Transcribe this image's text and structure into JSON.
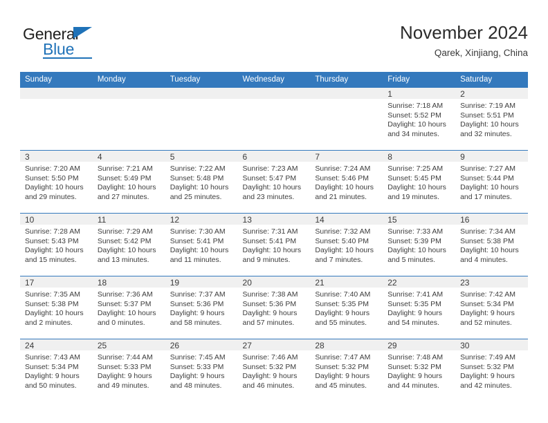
{
  "brand": {
    "name_top": "General",
    "name_bottom": "Blue",
    "accent_color": "#1f72b8"
  },
  "header": {
    "title": "November 2024",
    "subtitle": "Qarek, Xinjiang, China"
  },
  "calendar": {
    "header_background": "#3479bd",
    "weekday_headers": [
      "Sunday",
      "Monday",
      "Tuesday",
      "Wednesday",
      "Thursday",
      "Friday",
      "Saturday"
    ],
    "weeks": [
      [
        {
          "day": "",
          "empty": true
        },
        {
          "day": "",
          "empty": true
        },
        {
          "day": "",
          "empty": true
        },
        {
          "day": "",
          "empty": true
        },
        {
          "day": "",
          "empty": true
        },
        {
          "day": "1",
          "sunrise": "Sunrise: 7:18 AM",
          "sunset": "Sunset: 5:52 PM",
          "daylight_line1": "Daylight: 10 hours",
          "daylight_line2": "and 34 minutes."
        },
        {
          "day": "2",
          "sunrise": "Sunrise: 7:19 AM",
          "sunset": "Sunset: 5:51 PM",
          "daylight_line1": "Daylight: 10 hours",
          "daylight_line2": "and 32 minutes."
        }
      ],
      [
        {
          "day": "3",
          "sunrise": "Sunrise: 7:20 AM",
          "sunset": "Sunset: 5:50 PM",
          "daylight_line1": "Daylight: 10 hours",
          "daylight_line2": "and 29 minutes."
        },
        {
          "day": "4",
          "sunrise": "Sunrise: 7:21 AM",
          "sunset": "Sunset: 5:49 PM",
          "daylight_line1": "Daylight: 10 hours",
          "daylight_line2": "and 27 minutes."
        },
        {
          "day": "5",
          "sunrise": "Sunrise: 7:22 AM",
          "sunset": "Sunset: 5:48 PM",
          "daylight_line1": "Daylight: 10 hours",
          "daylight_line2": "and 25 minutes."
        },
        {
          "day": "6",
          "sunrise": "Sunrise: 7:23 AM",
          "sunset": "Sunset: 5:47 PM",
          "daylight_line1": "Daylight: 10 hours",
          "daylight_line2": "and 23 minutes."
        },
        {
          "day": "7",
          "sunrise": "Sunrise: 7:24 AM",
          "sunset": "Sunset: 5:46 PM",
          "daylight_line1": "Daylight: 10 hours",
          "daylight_line2": "and 21 minutes."
        },
        {
          "day": "8",
          "sunrise": "Sunrise: 7:25 AM",
          "sunset": "Sunset: 5:45 PM",
          "daylight_line1": "Daylight: 10 hours",
          "daylight_line2": "and 19 minutes."
        },
        {
          "day": "9",
          "sunrise": "Sunrise: 7:27 AM",
          "sunset": "Sunset: 5:44 PM",
          "daylight_line1": "Daylight: 10 hours",
          "daylight_line2": "and 17 minutes."
        }
      ],
      [
        {
          "day": "10",
          "sunrise": "Sunrise: 7:28 AM",
          "sunset": "Sunset: 5:43 PM",
          "daylight_line1": "Daylight: 10 hours",
          "daylight_line2": "and 15 minutes."
        },
        {
          "day": "11",
          "sunrise": "Sunrise: 7:29 AM",
          "sunset": "Sunset: 5:42 PM",
          "daylight_line1": "Daylight: 10 hours",
          "daylight_line2": "and 13 minutes."
        },
        {
          "day": "12",
          "sunrise": "Sunrise: 7:30 AM",
          "sunset": "Sunset: 5:41 PM",
          "daylight_line1": "Daylight: 10 hours",
          "daylight_line2": "and 11 minutes."
        },
        {
          "day": "13",
          "sunrise": "Sunrise: 7:31 AM",
          "sunset": "Sunset: 5:41 PM",
          "daylight_line1": "Daylight: 10 hours",
          "daylight_line2": "and 9 minutes."
        },
        {
          "day": "14",
          "sunrise": "Sunrise: 7:32 AM",
          "sunset": "Sunset: 5:40 PM",
          "daylight_line1": "Daylight: 10 hours",
          "daylight_line2": "and 7 minutes."
        },
        {
          "day": "15",
          "sunrise": "Sunrise: 7:33 AM",
          "sunset": "Sunset: 5:39 PM",
          "daylight_line1": "Daylight: 10 hours",
          "daylight_line2": "and 5 minutes."
        },
        {
          "day": "16",
          "sunrise": "Sunrise: 7:34 AM",
          "sunset": "Sunset: 5:38 PM",
          "daylight_line1": "Daylight: 10 hours",
          "daylight_line2": "and 4 minutes."
        }
      ],
      [
        {
          "day": "17",
          "sunrise": "Sunrise: 7:35 AM",
          "sunset": "Sunset: 5:38 PM",
          "daylight_line1": "Daylight: 10 hours",
          "daylight_line2": "and 2 minutes."
        },
        {
          "day": "18",
          "sunrise": "Sunrise: 7:36 AM",
          "sunset": "Sunset: 5:37 PM",
          "daylight_line1": "Daylight: 10 hours",
          "daylight_line2": "and 0 minutes."
        },
        {
          "day": "19",
          "sunrise": "Sunrise: 7:37 AM",
          "sunset": "Sunset: 5:36 PM",
          "daylight_line1": "Daylight: 9 hours",
          "daylight_line2": "and 58 minutes."
        },
        {
          "day": "20",
          "sunrise": "Sunrise: 7:38 AM",
          "sunset": "Sunset: 5:36 PM",
          "daylight_line1": "Daylight: 9 hours",
          "daylight_line2": "and 57 minutes."
        },
        {
          "day": "21",
          "sunrise": "Sunrise: 7:40 AM",
          "sunset": "Sunset: 5:35 PM",
          "daylight_line1": "Daylight: 9 hours",
          "daylight_line2": "and 55 minutes."
        },
        {
          "day": "22",
          "sunrise": "Sunrise: 7:41 AM",
          "sunset": "Sunset: 5:35 PM",
          "daylight_line1": "Daylight: 9 hours",
          "daylight_line2": "and 54 minutes."
        },
        {
          "day": "23",
          "sunrise": "Sunrise: 7:42 AM",
          "sunset": "Sunset: 5:34 PM",
          "daylight_line1": "Daylight: 9 hours",
          "daylight_line2": "and 52 minutes."
        }
      ],
      [
        {
          "day": "24",
          "sunrise": "Sunrise: 7:43 AM",
          "sunset": "Sunset: 5:34 PM",
          "daylight_line1": "Daylight: 9 hours",
          "daylight_line2": "and 50 minutes."
        },
        {
          "day": "25",
          "sunrise": "Sunrise: 7:44 AM",
          "sunset": "Sunset: 5:33 PM",
          "daylight_line1": "Daylight: 9 hours",
          "daylight_line2": "and 49 minutes."
        },
        {
          "day": "26",
          "sunrise": "Sunrise: 7:45 AM",
          "sunset": "Sunset: 5:33 PM",
          "daylight_line1": "Daylight: 9 hours",
          "daylight_line2": "and 48 minutes."
        },
        {
          "day": "27",
          "sunrise": "Sunrise: 7:46 AM",
          "sunset": "Sunset: 5:32 PM",
          "daylight_line1": "Daylight: 9 hours",
          "daylight_line2": "and 46 minutes."
        },
        {
          "day": "28",
          "sunrise": "Sunrise: 7:47 AM",
          "sunset": "Sunset: 5:32 PM",
          "daylight_line1": "Daylight: 9 hours",
          "daylight_line2": "and 45 minutes."
        },
        {
          "day": "29",
          "sunrise": "Sunrise: 7:48 AM",
          "sunset": "Sunset: 5:32 PM",
          "daylight_line1": "Daylight: 9 hours",
          "daylight_line2": "and 44 minutes."
        },
        {
          "day": "30",
          "sunrise": "Sunrise: 7:49 AM",
          "sunset": "Sunset: 5:32 PM",
          "daylight_line1": "Daylight: 9 hours",
          "daylight_line2": "and 42 minutes."
        }
      ]
    ]
  }
}
